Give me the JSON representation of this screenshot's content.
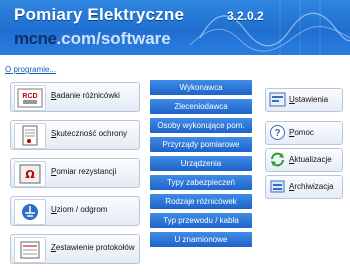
{
  "header": {
    "title": "Pomiary Elektryczne",
    "version": "3.2.0.2",
    "brand": "mcne",
    "brand_suffix": ".com/software"
  },
  "about_link": "O programie...",
  "left_buttons": [
    {
      "hot": "B",
      "rest": "adanie różnicówki",
      "icon": "rcd-icon",
      "icon_text": "RCD"
    },
    {
      "hot": "S",
      "rest": "kuteczność ochrony",
      "icon": "document-icon"
    },
    {
      "hot": "P",
      "rest": "omiar rezystancji",
      "icon": "ohm-meter-icon",
      "icon_text": "Ω"
    },
    {
      "hot": "U",
      "rest": "ziom / odgrom",
      "icon": "ground-icon"
    },
    {
      "hot": "Z",
      "rest": "estawienie protokołów",
      "icon": "report-icon"
    }
  ],
  "middle_buttons": [
    "Wykonawca",
    "Zleceniodawca",
    "Osoby wykonujące pom.",
    "Przyrządy pomiarowe",
    "Urządzenia",
    "Typy zabezpieczeń",
    "Rodzaje różnicówek",
    "Typ przewodu / kabla",
    "U znamionowe"
  ],
  "right_buttons": [
    {
      "hot": "U",
      "rest": "stawienia",
      "icon": "settings-icon"
    },
    {
      "hot": "P",
      "rest": "omoc",
      "icon": "help-icon"
    },
    {
      "hot": "A",
      "rest": "ktualizacje",
      "icon": "refresh-icon"
    },
    {
      "hot": "A",
      "rest": "rchiwizacja",
      "icon": "archive-icon"
    }
  ],
  "colors": {
    "banner": "#1f6fd0",
    "button_blue": "#1e63c9",
    "link": "#1a56b8"
  }
}
